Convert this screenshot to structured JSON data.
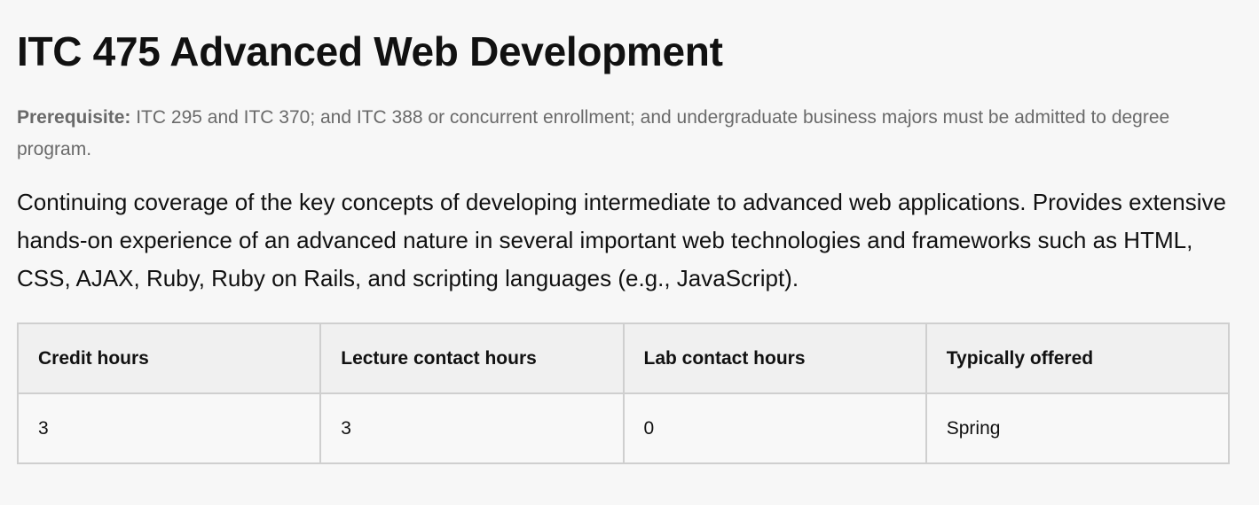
{
  "course": {
    "title": "ITC 475 Advanced Web Development",
    "prerequisite_label": "Prerequisite:",
    "prerequisite_text": " ITC 295 and ITC 370; and ITC 388 or concurrent enrollment; and undergraduate business majors must be admitted to degree program.",
    "description": "Continuing coverage of the key concepts of developing intermediate to advanced web applications. Provides extensive hands-on experience of an advanced nature in several important web technologies and frameworks such as HTML, CSS, AJAX, Ruby, Ruby on Rails, and scripting languages (e.g., JavaScript)."
  },
  "details_table": {
    "headers": [
      "Credit hours",
      "Lecture contact hours",
      "Lab contact hours",
      "Typically offered"
    ],
    "row": [
      "3",
      "3",
      "0",
      "Spring"
    ]
  }
}
